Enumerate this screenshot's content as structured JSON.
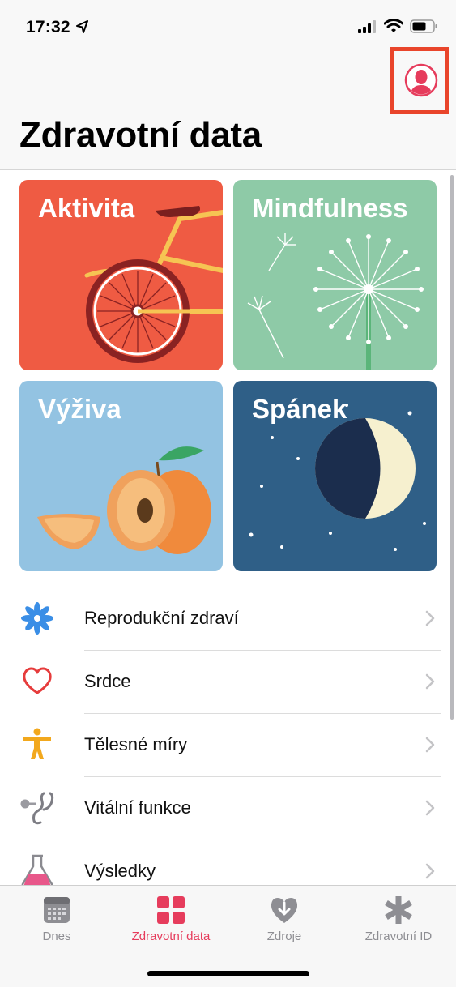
{
  "status": {
    "time": "17:32"
  },
  "header": {
    "title": "Zdravotní data"
  },
  "tiles": [
    {
      "label": "Aktivita",
      "color": "#ef5b43"
    },
    {
      "label": "Mindfulness",
      "color": "#8ecaa7"
    },
    {
      "label": "Výživa",
      "color": "#93c3e2"
    },
    {
      "label": "Spánek",
      "color": "#2f5f87"
    }
  ],
  "categories": [
    {
      "label": "Reprodukční zdraví",
      "icon": "flower-icon"
    },
    {
      "label": "Srdce",
      "icon": "heart-icon"
    },
    {
      "label": "Tělesné míry",
      "icon": "body-figure-icon"
    },
    {
      "label": "Vitální funkce",
      "icon": "stethoscope-icon"
    },
    {
      "label": "Výsledky",
      "icon": "flask-icon"
    }
  ],
  "tabbar": {
    "tabs": [
      {
        "label": "Dnes",
        "icon": "calendar-icon",
        "active": false
      },
      {
        "label": "Zdravotní data",
        "icon": "grid-icon",
        "active": true
      },
      {
        "label": "Zdroje",
        "icon": "heart-download-icon",
        "active": false
      },
      {
        "label": "Zdravotní ID",
        "icon": "asterisk-icon",
        "active": false
      }
    ]
  },
  "colors": {
    "accent": "#e63c5c",
    "highlight": "#e9452b"
  }
}
